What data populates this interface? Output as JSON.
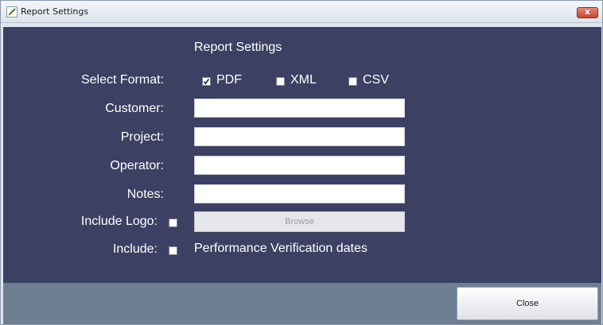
{
  "window": {
    "title": "Report Settings",
    "close_label": "x"
  },
  "form": {
    "heading": "Report Settings",
    "select_format_label": "Select Format:",
    "formats": [
      {
        "label": "PDF",
        "checked": true
      },
      {
        "label": "XML",
        "checked": false
      },
      {
        "label": "CSV",
        "checked": false
      }
    ],
    "customer_label": "Customer:",
    "customer_value": "",
    "project_label": "Project:",
    "project_value": "",
    "operator_label": "Operator:",
    "operator_value": "",
    "notes_label": "Notes:",
    "notes_value": "",
    "include_logo_label": "Include Logo:",
    "include_logo_checked": false,
    "browse_label": "Browse",
    "include_label": "Include:",
    "include_perf_checked": false,
    "perf_text": "Performance Verification dates"
  },
  "footer": {
    "close_label": "Close"
  },
  "colors": {
    "content_bg": "#3c4062",
    "footer_bg": "#6e7f92",
    "titlebar_close": "#c6442c"
  }
}
